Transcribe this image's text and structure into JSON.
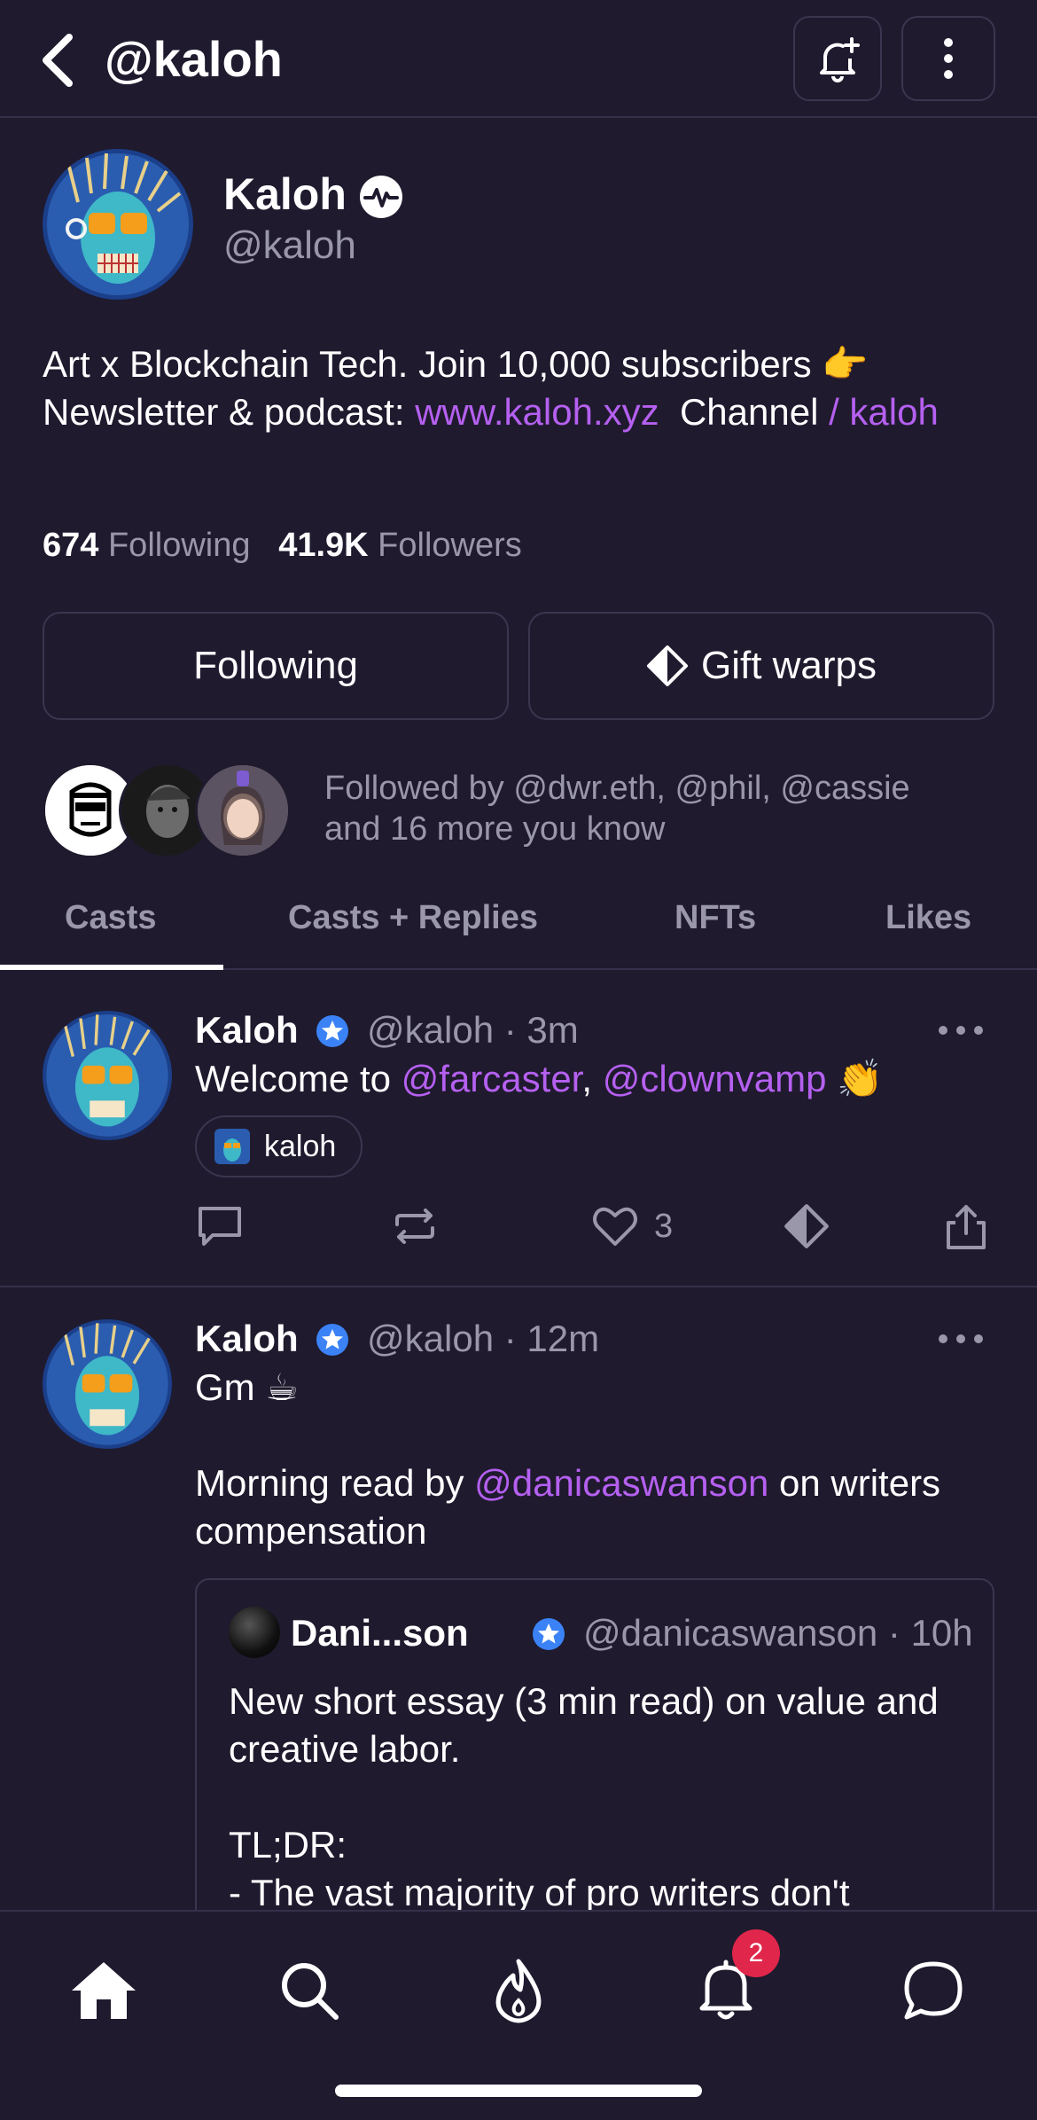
{
  "header": {
    "title": "@kaloh",
    "icons": [
      "chevron-left-icon",
      "bell-plus-icon",
      "more-vertical-icon"
    ]
  },
  "profile": {
    "display_name": "Kaloh",
    "handle": "@kaloh",
    "bio_part1": "Art x Blockchain Tech. Join 10,000 subscribers ",
    "bio_emoji": "👉",
    "bio_part2": "Newsletter & podcast: ",
    "bio_link": "www.kaloh.xyz",
    "bio_part3": "  Channel ",
    "bio_channel": "/ kaloh",
    "following_count": "674",
    "following_label": "Following",
    "followers_count": "41.9K",
    "followers_label": "Followers",
    "following_button": "Following",
    "gift_button": "Gift warps",
    "followed_by": "Followed by @dwr.eth, @phil, @cassie and 16 more you know"
  },
  "tabs": [
    "Casts",
    "Casts + Replies",
    "NFTs",
    "Likes"
  ],
  "casts": [
    {
      "name": "Kaloh",
      "handle": "@kaloh",
      "sep": "·",
      "time": "3m",
      "text_pre": "Welcome to ",
      "mention1": "@farcaster",
      "text_mid": ", ",
      "mention2": "@clownvamp",
      "emoji": "👏",
      "channel": "kaloh",
      "likes": "3"
    },
    {
      "name": "Kaloh",
      "handle": "@kaloh",
      "sep": "·",
      "time": "12m",
      "line1": "Gm ☕",
      "text_pre": "Morning read by ",
      "mention": "@danicaswanson",
      "text_post": " on writers compensation",
      "quote": {
        "name": "Dani...son",
        "handle": "@danicaswanson",
        "sep": "·",
        "time": "10h",
        "line1": "New short essay (3 min read) on value and creative labor.",
        "line2": "TL;DR:",
        "line3": "- The vast majority of pro writers don't"
      }
    }
  ],
  "nav": {
    "items": [
      "home-icon",
      "search-icon",
      "flame-icon",
      "bell-icon",
      "chat-icon"
    ],
    "notification_count": "2"
  },
  "colors": {
    "background": "#1f1a2e",
    "accent": "#b560f0",
    "muted": "#9b97ab",
    "badge": "#e0264a",
    "verified": "#3b82f6"
  }
}
